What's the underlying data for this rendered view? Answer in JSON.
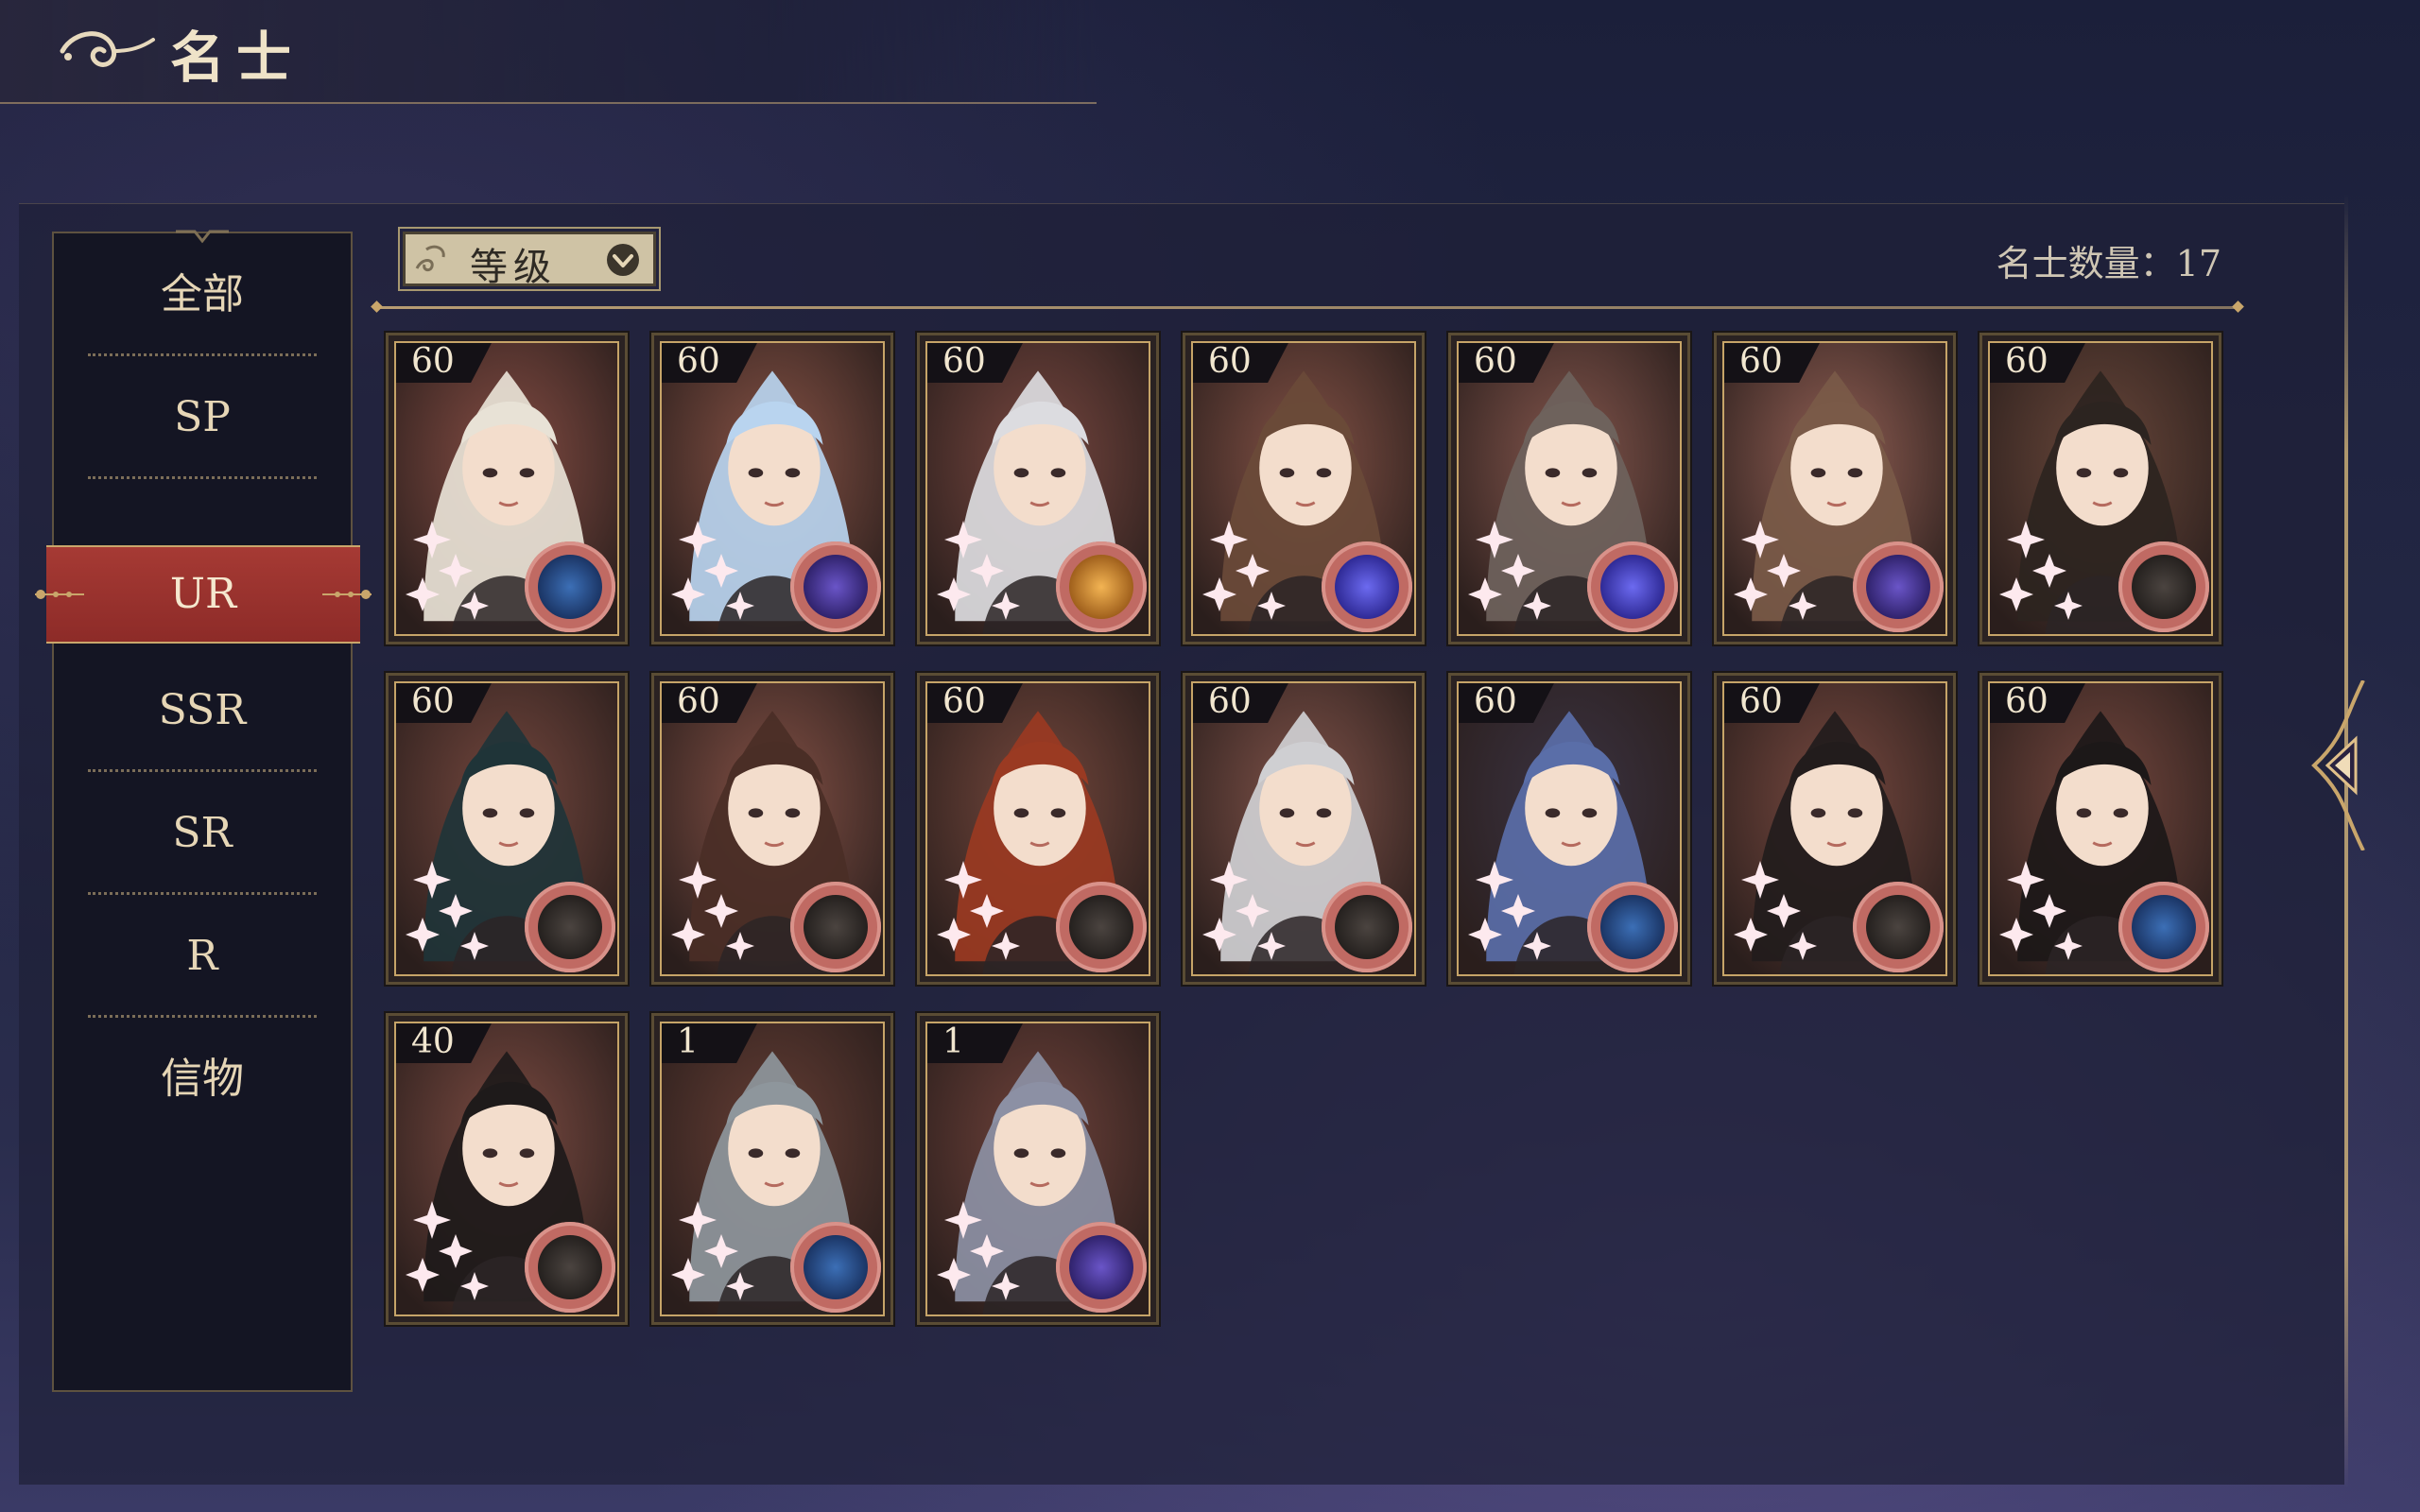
{
  "header": {
    "title": "名士"
  },
  "sidebar": {
    "items": [
      {
        "label": "全部",
        "active": false
      },
      {
        "label": "SP",
        "active": false
      },
      {
        "label": "UR",
        "active": true
      },
      {
        "label": "SSR",
        "active": false
      },
      {
        "label": "SR",
        "active": false
      },
      {
        "label": "R",
        "active": false
      },
      {
        "label": "信物",
        "active": false
      }
    ]
  },
  "filter": {
    "label": "等级",
    "icon": "chevron-down-icon"
  },
  "count": {
    "text": "名士数量：17"
  },
  "colors": {
    "accent_red": "#9b302d",
    "gold": "#c9a66b",
    "panel_dark": "#141523"
  },
  "cards": [
    {
      "level": "60",
      "hair": "#e8e2d6",
      "bg": "#8c5046",
      "badge": "compass-blue-icon"
    },
    {
      "level": "60",
      "hair": "#b9d4ef",
      "bg": "#8e5648",
      "badge": "planet-purple-icon"
    },
    {
      "level": "60",
      "hair": "#dcdce0",
      "bg": "#7e4a42",
      "badge": "sun-gold-icon"
    },
    {
      "level": "60",
      "hair": "#6a4a38",
      "bg": "#8a5548",
      "badge": "planet-violet-icon"
    },
    {
      "level": "60",
      "hair": "#6e625c",
      "bg": "#8b5a50",
      "badge": "planet-violet-icon"
    },
    {
      "level": "60",
      "hair": "#7a5a48",
      "bg": "#9a6458",
      "badge": "planet-purple-icon"
    },
    {
      "level": "60",
      "hair": "#2c2420",
      "bg": "#6e4a3c",
      "badge": "compass-dark-icon"
    },
    {
      "level": "60",
      "hair": "#1f3438",
      "bg": "#7a4a40",
      "badge": "compass-dark-icon"
    },
    {
      "level": "60",
      "hair": "#4a2e26",
      "bg": "#8a5448",
      "badge": "compass-dark-icon"
    },
    {
      "level": "60",
      "hair": "#9a3a22",
      "bg": "#7a4a3e",
      "badge": "compass-dark-icon"
    },
    {
      "level": "60",
      "hair": "#cfcfd2",
      "bg": "#86564c",
      "badge": "compass-dark-icon"
    },
    {
      "level": "60",
      "hair": "#5a6ea8",
      "bg": "#3c3444",
      "badge": "compass-blue-icon"
    },
    {
      "level": "60",
      "hair": "#221c1c",
      "bg": "#7e4c42",
      "badge": "compass-dark-icon"
    },
    {
      "level": "60",
      "hair": "#1c1818",
      "bg": "#7a4a40",
      "badge": "compass-blue-icon"
    },
    {
      "level": "40",
      "hair": "#1e1a1a",
      "bg": "#824e44",
      "badge": "compass-dark-icon"
    },
    {
      "level": "1",
      "hair": "#8e969c",
      "bg": "#6a4036",
      "badge": "compass-blue-icon"
    },
    {
      "level": "1",
      "hair": "#8c90a4",
      "bg": "#74443c",
      "badge": "planet-purple-icon"
    }
  ]
}
